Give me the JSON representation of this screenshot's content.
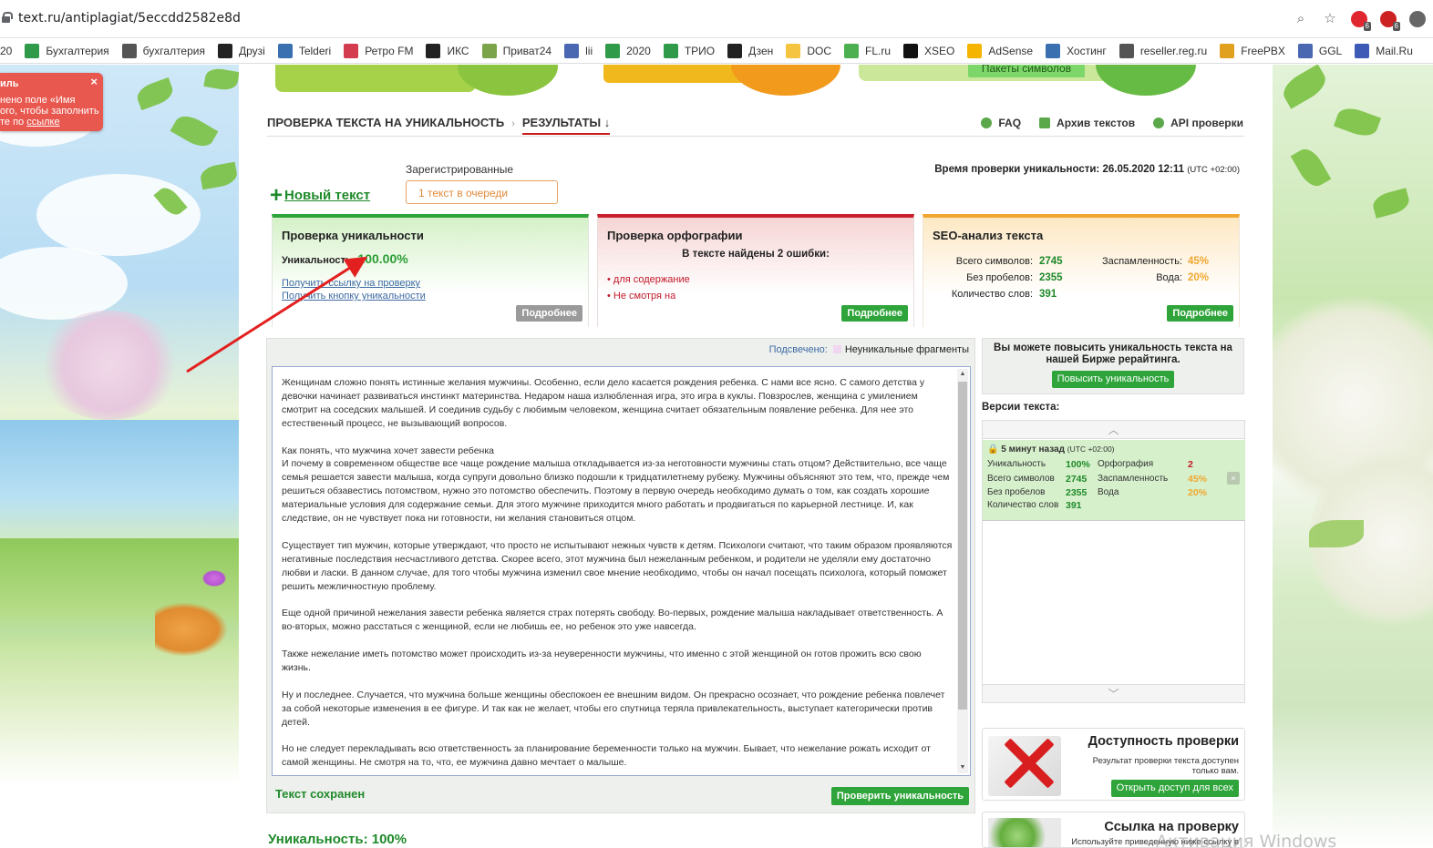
{
  "browser": {
    "url": "text.ru/antiplagiat/5eccdd2582e8d",
    "extension_badges": [
      "6",
      "6"
    ]
  },
  "bookmarks": [
    {
      "label": "20",
      "icon": "bookmark-icon",
      "color": "#ffffff"
    },
    {
      "label": "Бухгалтерия",
      "icon": "plus-icon",
      "color": "#2e9a4a"
    },
    {
      "label": "бухгалтерия",
      "icon": "gear-icon",
      "color": "#555555"
    },
    {
      "label": "Друзі",
      "icon": "clapper-icon",
      "color": "#222222"
    },
    {
      "label": "Telderi",
      "icon": "monitor-icon",
      "color": "#3a6fb0"
    },
    {
      "label": "Ретро FM",
      "icon": "radio-icon",
      "color": "#d33b4f"
    },
    {
      "label": "ИКС",
      "icon": "star-icon",
      "color": "#222222"
    },
    {
      "label": "Приват24",
      "icon": "privat-icon",
      "color": "#7aa34a"
    },
    {
      "label": "lii",
      "icon": "chart-icon",
      "color": "#4a67b1"
    },
    {
      "label": "2020",
      "icon": "plus-icon",
      "color": "#2e9a4a"
    },
    {
      "label": "ТРИО",
      "icon": "plus-icon",
      "color": "#2e9a4a"
    },
    {
      "label": "Дзен",
      "icon": "dzen-icon",
      "color": "#222222"
    },
    {
      "label": "DOC",
      "icon": "doc-icon",
      "color": "#f5c542"
    },
    {
      "label": "FL.ru",
      "icon": "fl-icon",
      "color": "#4caf50"
    },
    {
      "label": "XSEO",
      "icon": "xseo-icon",
      "color": "#111111"
    },
    {
      "label": "AdSense",
      "icon": "adsense-icon",
      "color": "#f4b400"
    },
    {
      "label": "Хостинг",
      "icon": "hosting-icon",
      "color": "#3a6fb0"
    },
    {
      "label": "reseller.reg.ru",
      "icon": "globe-icon",
      "color": "#555555"
    },
    {
      "label": "FreePBX",
      "icon": "freepbx-icon",
      "color": "#e0a020"
    },
    {
      "label": "GGL",
      "icon": "chart-icon",
      "color": "#4a67b1"
    },
    {
      "label": "Mail.Ru",
      "icon": "mail-icon",
      "color": "#3d5ab6"
    }
  ],
  "popup": {
    "title": "иль",
    "lines": [
      "нено поле «Имя",
      "ого, чтобы заполнить",
      "те по "
    ],
    "link": "ссылке",
    "close": "×"
  },
  "banner": {
    "packet_label": "Пакеты символов"
  },
  "breadcrumbs": {
    "item1": "ПРОВЕРКА ТЕКСТА НА УНИКАЛЬНОСТЬ",
    "separator": "›",
    "item2": "РЕЗУЛЬТАТЫ ↓"
  },
  "toplinks": {
    "faq": "FAQ",
    "archive": "Архив текстов",
    "api": "API проверки"
  },
  "new_text": {
    "plus": "+",
    "label": "Новый текст"
  },
  "registered": {
    "label": "Зарегистрированные",
    "queue": "1 текст в очереди"
  },
  "check_time": {
    "label": "Время проверки уникальности: 26.05.2020 12:11",
    "tz": "(UTC +02:00)"
  },
  "card_uniqueness": {
    "title": "Проверка уникальности",
    "uniq_label": "Уникальность:",
    "uniq_value": "100.00%",
    "link1": "Получить ссылку на проверку",
    "link2": "Получить кнопку уникальности",
    "more": "Подробнее"
  },
  "card_spelling": {
    "title": "Проверка орфографии",
    "summary": "В тексте найдены 2 ошибки:",
    "errors": [
      "• для содержание",
      "• Не смотря на"
    ],
    "more": "Подробнее"
  },
  "card_seo": {
    "title": "SEO-анализ текста",
    "total_label": "Всего символов:",
    "total_value": "2745",
    "nospace_label": "Без пробелов:",
    "nospace_value": "2355",
    "words_label": "Количество слов:",
    "words_value": "391",
    "spam_label": "Заспамленность:",
    "spam_value": "45%",
    "water_label": "Вода:",
    "water_value": "20%",
    "more": "Подробнее"
  },
  "text_panel": {
    "highlight_label": "Подсвечено:",
    "highlight_legend": "Неуникальные фрагменты",
    "content": "Женщинам сложно понять истинные желания мужчины. Особенно, если дело касается рождения ребенка. С нами все ясно. С самого детства у девочки начинает развиваться инстинкт материнства. Недаром наша излюбленная игра, это игра в куклы. Повзрослев, женщина с умилением смотрит на соседских малышей. И соединив судьбу с любимым человеком, женщина считает обязательным появление ребенка. Для нее это естественный процесс, не вызывающий вопросов.\n\nКак понять, что мужчина хочет завести ребенка\nИ почему в современном обществе все чаще рождение малыша откладывается из-за неготовности мужчины стать отцом? Действительно, все чаще семья решается завести малыша, когда супруги довольно близко подошли к тридцатилетнему рубежу. Мужчины объясняют это тем, что, прежде чем решиться обзавестись потомством, нужно это потомство обеспечить. Поэтому в первую очередь необходимо думать о том, как создать хорошие материальные условия для содержание семьи. Для этого мужчине приходится много работать и продвигаться по карьерной лестнице. И, как следствие, он не чувствует пока ни готовности, ни желания становиться отцом.\n\nСуществует тип мужчин, которые утверждают, что просто не испытывают нежных чувств к детям. Психологи считают, что таким образом проявляются негативные последствия несчастливого детства. Скорее всего, этот мужчина был нежеланным ребенком, и родители не уделяли ему достаточно любви и ласки. В данном случае, для того чтобы мужчина изменил свое мнение необходимо, чтобы он начал посещать психолога, который поможет решить межличностную проблему.\n\nЕще одной причиной нежелания завести ребенка является страх потерять свободу. Во-первых, рождение малыша накладывает ответственность. А во-вторых, можно расстаться с женщиной, если не любишь ее, но ребенок это уже навсегда.\n\nТакже нежелание иметь потомство может происходить из-за неуверенности мужчины, что именно с этой женщиной он готов прожить всю свою жизнь.\n\nНу и последнее. Случается, что мужчина больше женщины обеспокоен ее внешним видом. Он прекрасно осознает, что рождение ребенка повлечет за собой некоторые изменения в ее фигуре. И так как не желает, чтобы его спутница теряла привлекательность, выступает категорически против детей.\n\nНо не следует перекладывать всю ответственность за планирование беременности только на мужчин. Бывает, что нежелание рожать исходит от самой женщины. Не смотря на то, что, ее мужчина давно мечтает о малыше.",
    "saved": "Текст сохранен",
    "check_button": "Проверить уникальность"
  },
  "bottom_uniq": "Уникальность: 100%",
  "promo": {
    "text": "Вы можете повысить уникальность текста на нашей Бирже рерайтинга.",
    "button": "Повысить уникальность"
  },
  "versions": {
    "label": "Версии текста:",
    "item": {
      "when": "5 минут назад",
      "tz": "(UTC +02:00)",
      "uniq_label": "Уникальность",
      "uniq_value": "100%",
      "total_label": "Всего символов",
      "total_value": "2745",
      "nospace_label": "Без пробелов",
      "nospace_value": "2355",
      "words_label": "Количество слов",
      "words_value": "391",
      "spell_label": "Орфография",
      "spell_value": "2",
      "spam_label": "Заспамленность",
      "spam_value": "45%",
      "water_label": "Вода",
      "water_value": "20%",
      "close": "×"
    }
  },
  "access": {
    "title": "Доступность проверки",
    "text": "Результат проверки текста доступен только вам.",
    "button": "Открыть доступ для всех"
  },
  "link_card": {
    "title": "Ссылка на проверку",
    "text": "Используйте приведенную ниже ссылку в"
  },
  "watermark": "Активация Windows",
  "colors": {
    "green": "#2ea43a",
    "red": "#c9202e",
    "orange": "#f0a730",
    "link": "#3c6aa3"
  }
}
